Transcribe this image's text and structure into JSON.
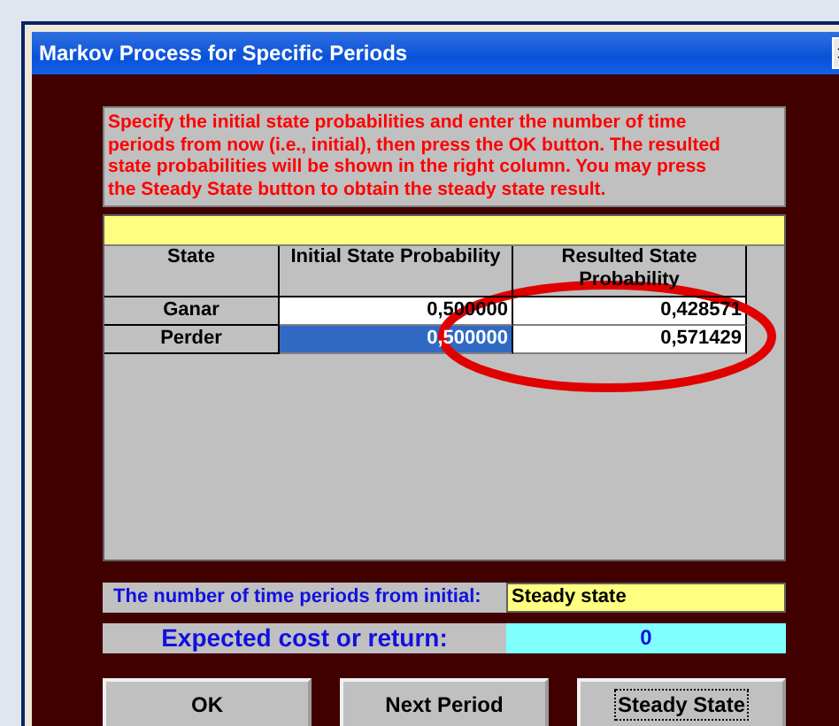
{
  "window": {
    "title": "Markov Process for Specific Periods"
  },
  "instructions": "Specify the initial state probabilities and enter the number of time periods from now (i.e., initial), then press the OK button.  The resulted state probabilities will be shown in the right column.  You may press the Steady State button to obtain the steady state result.",
  "grid": {
    "columns": [
      "State",
      "Initial State Probability",
      "Resulted State Probability"
    ],
    "rows": [
      {
        "state": "Ganar",
        "initial": "0,500000",
        "resulted": "0,428571",
        "selected": false
      },
      {
        "state": "Perder",
        "initial": "0,500000",
        "resulted": "0,571429",
        "selected": true
      }
    ]
  },
  "periods": {
    "label": "The number of time periods from initial:",
    "value": "Steady state"
  },
  "cost": {
    "label": "Expected cost or return:",
    "value": "0"
  },
  "buttons": [
    {
      "label": "OK",
      "focused": false
    },
    {
      "label": "Next Period",
      "focused": false
    },
    {
      "label": "Steady State",
      "focused": true
    }
  ],
  "annotation": {
    "kind": "ellipse"
  }
}
